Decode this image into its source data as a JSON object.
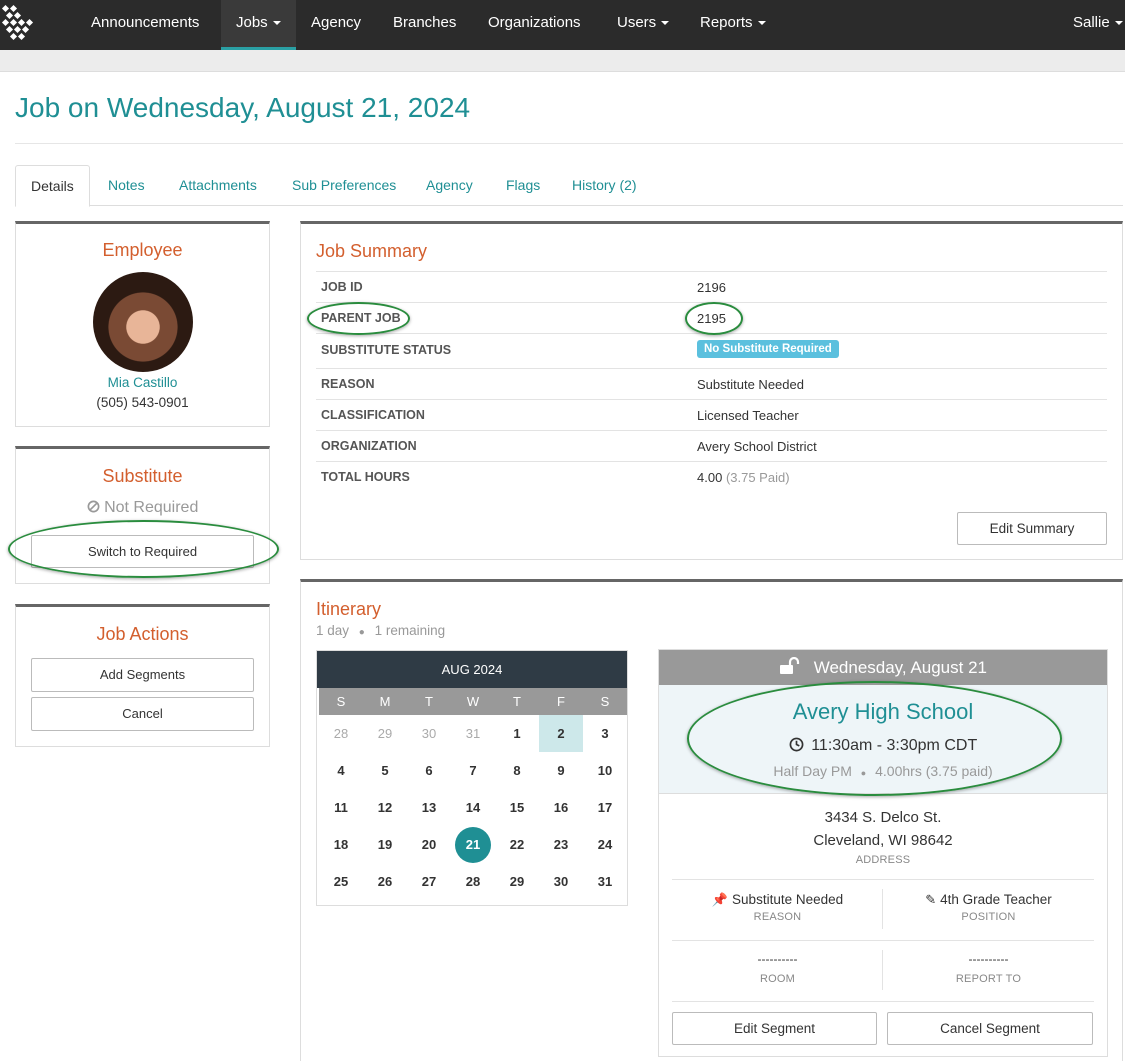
{
  "nav": {
    "items": [
      {
        "label": "Announcements"
      },
      {
        "label": "Jobs"
      },
      {
        "label": "Agency"
      },
      {
        "label": "Branches"
      },
      {
        "label": "Organizations"
      },
      {
        "label": "Users"
      },
      {
        "label": "Reports"
      }
    ],
    "user": "Sallie",
    "active_color": "#2aa0a4"
  },
  "page_title": "Job on Wednesday, August 21, 2024",
  "tabs": [
    "Details",
    "Notes",
    "Attachments",
    "Sub Preferences",
    "Agency",
    "Flags",
    "History (2)"
  ],
  "employee": {
    "title": "Employee",
    "name": "Mia Castillo",
    "phone": "(505) 543-0901"
  },
  "substitute": {
    "title": "Substitute",
    "status": "Not Required",
    "status_icon": "ban-icon",
    "switch_label": "Switch to Required"
  },
  "job_actions": {
    "title": "Job Actions",
    "add_segments": "Add Segments",
    "cancel": "Cancel"
  },
  "job_summary": {
    "title": "Job Summary",
    "rows": [
      {
        "key": "JOB ID",
        "value": "2196"
      },
      {
        "key": "PARENT JOB",
        "value": "2195"
      },
      {
        "key": "SUBSTITUTE STATUS",
        "value": "No Substitute Required"
      },
      {
        "key": "REASON",
        "value": "Substitute Needed"
      },
      {
        "key": "CLASSIFICATION",
        "value": "Licensed Teacher"
      },
      {
        "key": "ORGANIZATION",
        "value": "Avery School District"
      },
      {
        "key": "TOTAL HOURS",
        "value": "4.00",
        "extra": "(3.75 Paid)"
      }
    ],
    "edit_label": "Edit Summary"
  },
  "itinerary": {
    "title": "Itinerary",
    "days": "1 day",
    "remaining": "1 remaining",
    "calendar": {
      "month": "AUG 2024",
      "dow": [
        "S",
        "M",
        "T",
        "W",
        "T",
        "F",
        "S"
      ],
      "weeks": [
        [
          "28",
          "29",
          "30",
          "31",
          "1",
          "2",
          "3"
        ],
        [
          "4",
          "5",
          "6",
          "7",
          "8",
          "9",
          "10"
        ],
        [
          "11",
          "12",
          "13",
          "14",
          "15",
          "16",
          "17"
        ],
        [
          "18",
          "19",
          "20",
          "21",
          "22",
          "23",
          "24"
        ],
        [
          "25",
          "26",
          "27",
          "28",
          "29",
          "30",
          "31"
        ]
      ],
      "selected": "21"
    },
    "segment": {
      "date": "Wednesday, August 21",
      "lock_icon": "unlock-icon",
      "school": "Avery High School",
      "time": "11:30am - 3:30pm CDT",
      "duration": "Half Day PM",
      "hours": "4.00hrs",
      "paid": "(3.75 paid)",
      "address_line1": "3434 S. Delco St.",
      "address_line2": "Cleveland, WI 98642",
      "address_label": "ADDRESS",
      "reason": "Substitute Needed",
      "reason_label": "REASON",
      "position": "4th Grade Teacher",
      "position_label": "POSITION",
      "room": "----------",
      "room_label": "ROOM",
      "report_to": "----------",
      "report_to_label": "REPORT TO",
      "edit_label": "Edit Segment",
      "cancel_label": "Cancel Segment"
    }
  },
  "highlight_color": "#2a8c3e"
}
